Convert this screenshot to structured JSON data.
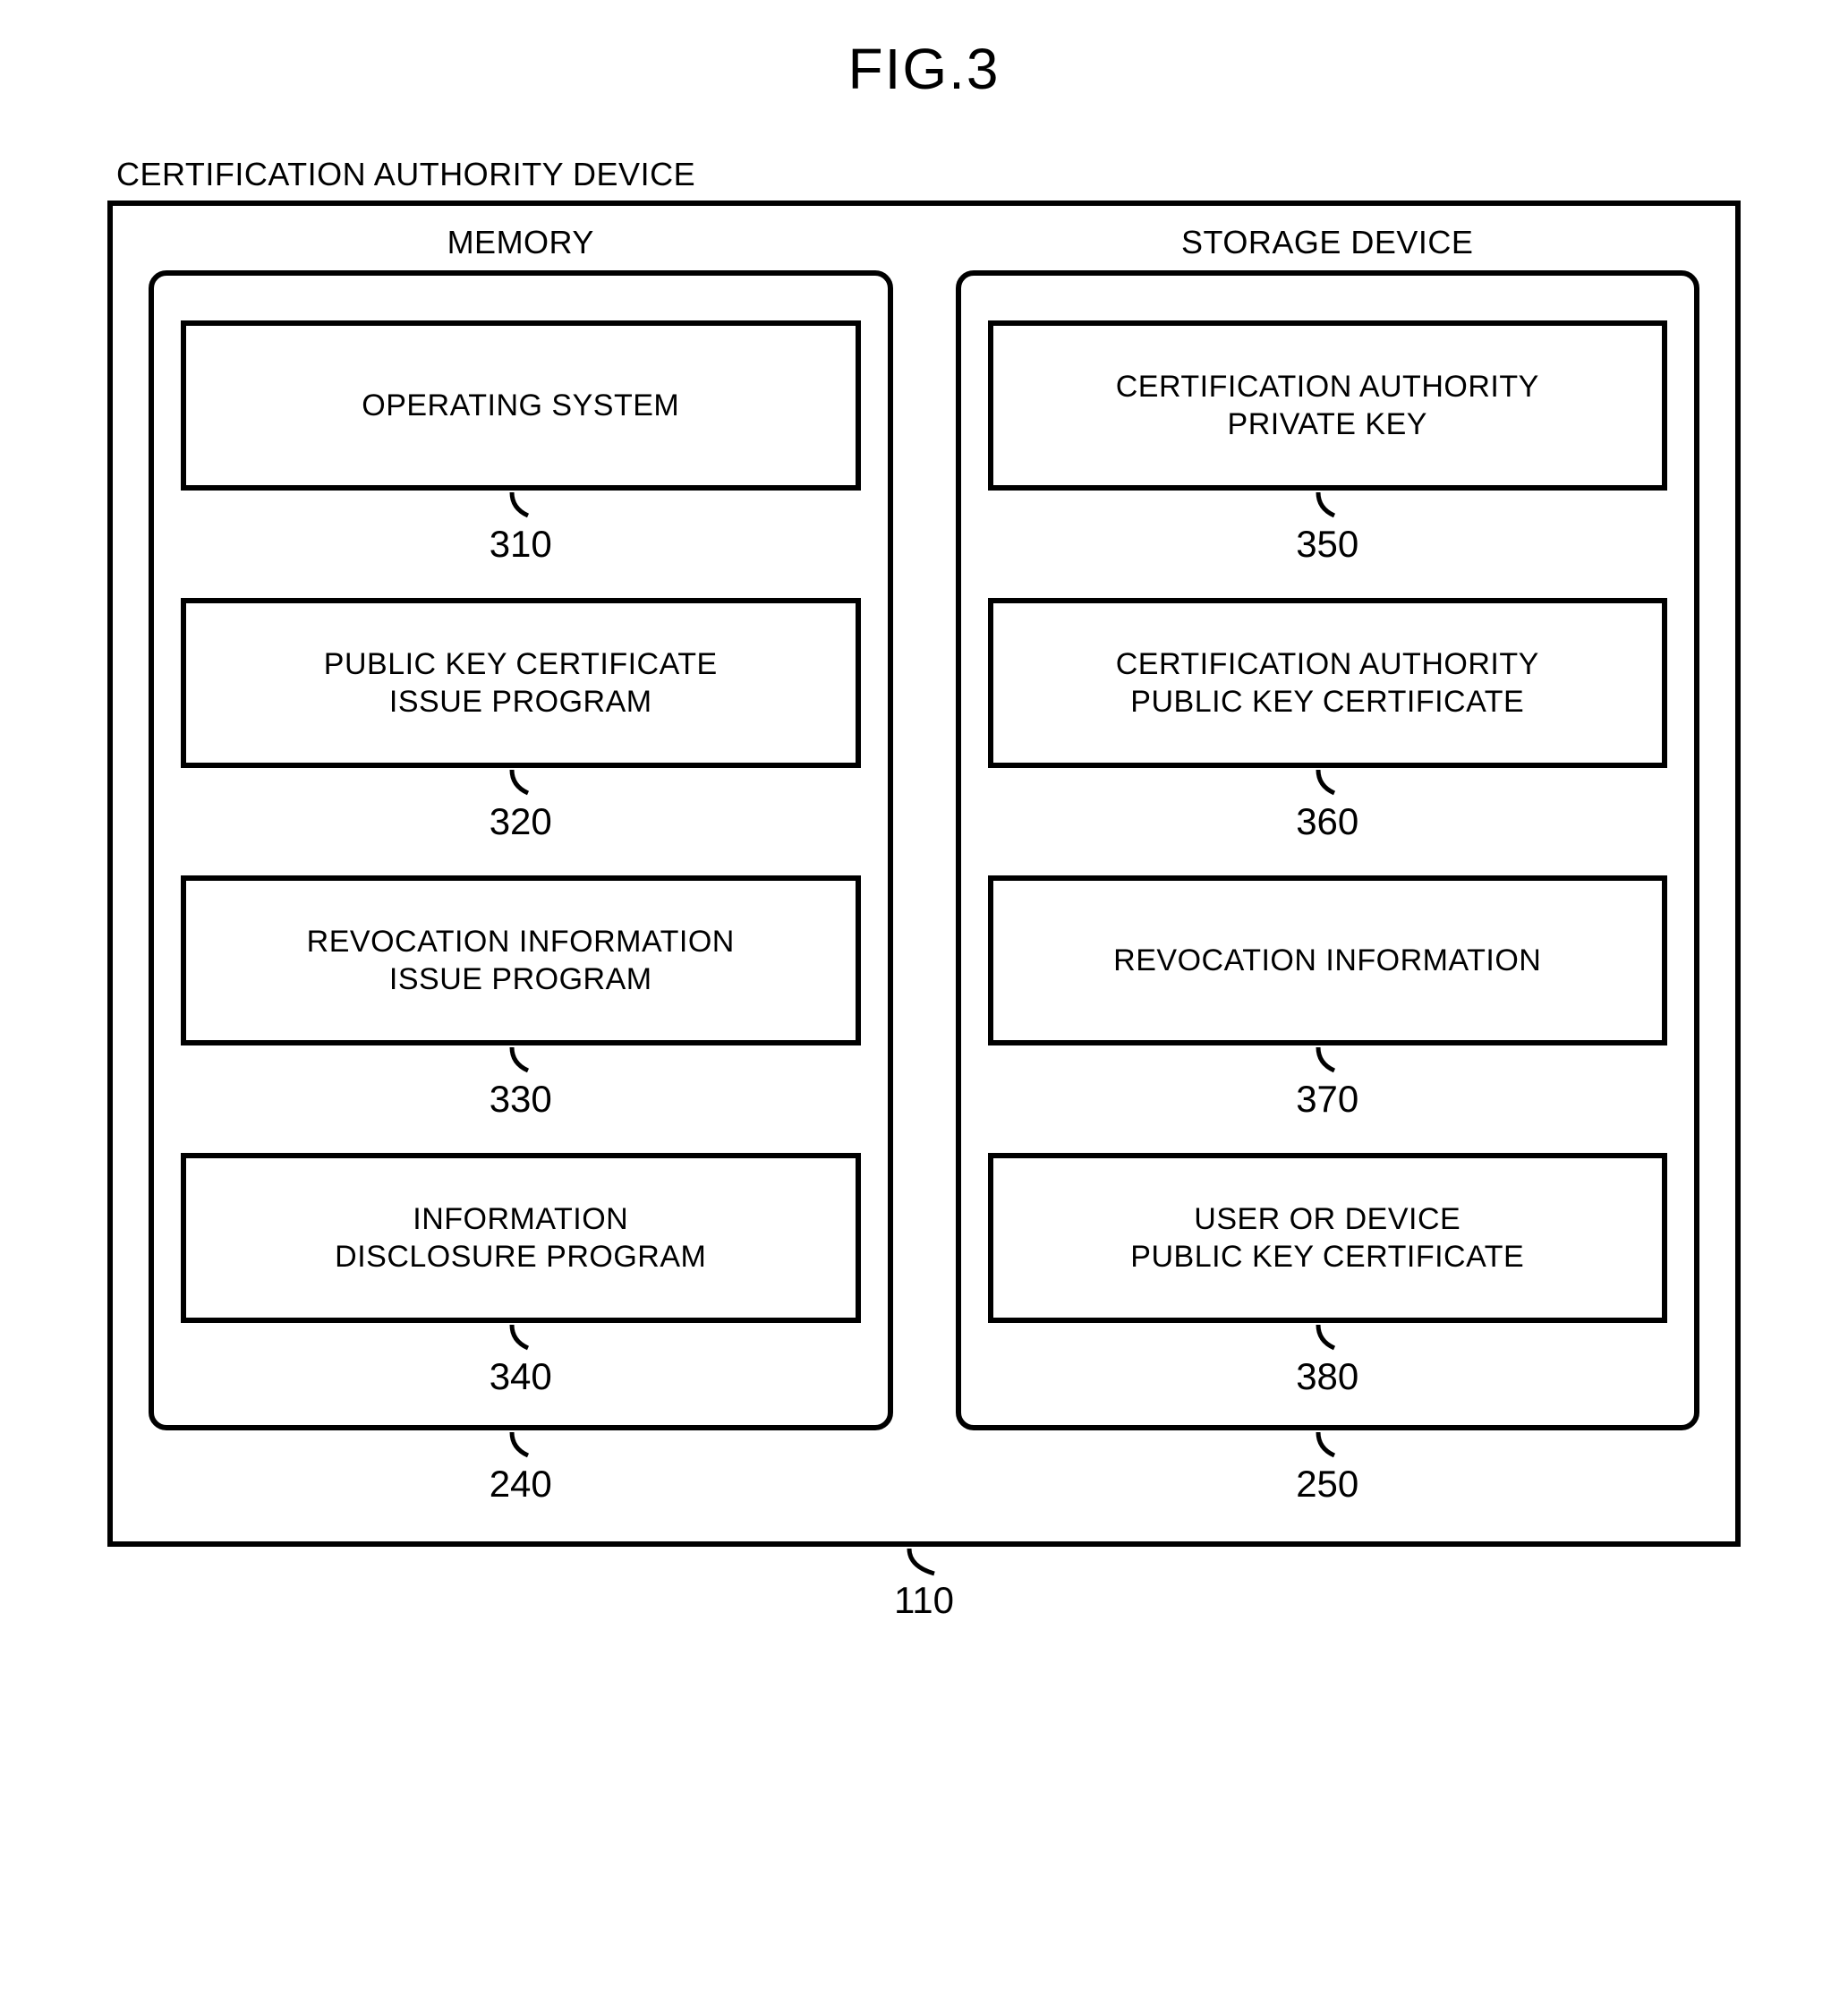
{
  "figure": {
    "title": "FIG.3",
    "device_label": "CERTIFICATION AUTHORITY DEVICE",
    "outer_ref": "110"
  },
  "columns": {
    "memory": {
      "title": "MEMORY",
      "ref": "240",
      "items": [
        {
          "line1": "OPERATING SYSTEM",
          "line2": "",
          "ref": "310"
        },
        {
          "line1": "PUBLIC KEY CERTIFICATE",
          "line2": "ISSUE PROGRAM",
          "ref": "320"
        },
        {
          "line1": "REVOCATION INFORMATION",
          "line2": "ISSUE PROGRAM",
          "ref": "330"
        },
        {
          "line1": "INFORMATION",
          "line2": "DISCLOSURE PROGRAM",
          "ref": "340"
        }
      ]
    },
    "storage": {
      "title": "STORAGE DEVICE",
      "ref": "250",
      "items": [
        {
          "line1": "CERTIFICATION AUTHORITY",
          "line2": "PRIVATE KEY",
          "ref": "350"
        },
        {
          "line1": "CERTIFICATION AUTHORITY",
          "line2": "PUBLIC KEY CERTIFICATE",
          "ref": "360"
        },
        {
          "line1": "REVOCATION INFORMATION",
          "line2": "",
          "ref": "370"
        },
        {
          "line1": "USER OR DEVICE",
          "line2": "PUBLIC KEY CERTIFICATE",
          "ref": "380"
        }
      ]
    }
  }
}
